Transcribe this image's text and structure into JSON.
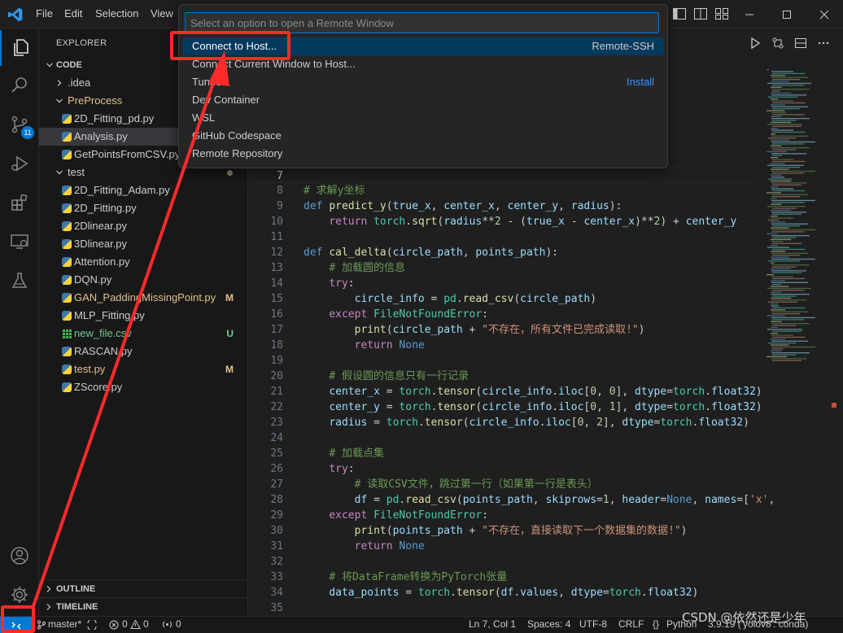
{
  "menu": {
    "file": "File",
    "edit": "Edit",
    "selection": "Selection",
    "view": "View"
  },
  "palette": {
    "placeholder": "Select an option to open a Remote Window",
    "items": [
      {
        "label": "Connect to Host...",
        "right": "Remote-SSH",
        "right_color": "#cccccc"
      },
      {
        "label": "Connect Current Window to Host...",
        "right": ""
      },
      {
        "label": "Tunnel",
        "right": "Install",
        "right_color": "#3794ff"
      },
      {
        "label": "Dev Container",
        "right": ""
      },
      {
        "label": "WSL",
        "right": ""
      },
      {
        "label": "GitHub Codespace",
        "right": ""
      },
      {
        "label": "Remote Repository",
        "right": ""
      }
    ]
  },
  "activity": {
    "scm_badge": "11"
  },
  "sidebar": {
    "header": "EXPLORER",
    "section": "CODE",
    "rows": [
      {
        "label": ".idea",
        "type": "folder",
        "open": false,
        "depth": 1,
        "color": "#cccccc",
        "badge": ""
      },
      {
        "label": "PreProcess",
        "type": "folder",
        "open": true,
        "depth": 1,
        "color": "#e2c08d",
        "badge": ""
      },
      {
        "label": "2D_Fitting_pd.py",
        "type": "py",
        "depth": 2,
        "color": "#cccccc",
        "badge": ""
      },
      {
        "label": "Analysis.py",
        "type": "py",
        "depth": 2,
        "color": "#cccccc",
        "badge": "",
        "selected": true
      },
      {
        "label": "GetPointsFromCSV.py",
        "type": "py",
        "depth": 2,
        "color": "#cccccc",
        "badge": ""
      },
      {
        "label": "test",
        "type": "folder",
        "open": true,
        "depth": 1,
        "color": "#cccccc",
        "badge": "dot"
      },
      {
        "label": "2D_Fitting_Adam.py",
        "type": "py",
        "depth": 2,
        "color": "#cccccc",
        "badge": ""
      },
      {
        "label": "2D_Fitting.py",
        "type": "py",
        "depth": 2,
        "color": "#cccccc",
        "badge": ""
      },
      {
        "label": "2Dlinear.py",
        "type": "py",
        "depth": 2,
        "color": "#cccccc",
        "badge": ""
      },
      {
        "label": "3Dlinear.py",
        "type": "py",
        "depth": 2,
        "color": "#cccccc",
        "badge": ""
      },
      {
        "label": "Attention.py",
        "type": "py",
        "depth": 2,
        "color": "#cccccc",
        "badge": ""
      },
      {
        "label": "DQN.py",
        "type": "py",
        "depth": 2,
        "color": "#cccccc",
        "badge": ""
      },
      {
        "label": "GAN_PaddingMissingPoint.py",
        "type": "py",
        "depth": 2,
        "color": "#e2c08d",
        "badge": "M",
        "badge_color": "#e2c08d"
      },
      {
        "label": "MLP_Fitting.py",
        "type": "py",
        "depth": 2,
        "color": "#cccccc",
        "badge": ""
      },
      {
        "label": "new_file.csv",
        "type": "csv",
        "depth": 2,
        "color": "#73c991",
        "badge": "U",
        "badge_color": "#73c991"
      },
      {
        "label": "RASCAN.py",
        "type": "py",
        "depth": 2,
        "color": "#cccccc",
        "badge": ""
      },
      {
        "label": "test.py",
        "type": "py",
        "depth": 2,
        "color": "#e2c08d",
        "badge": "M",
        "badge_color": "#e2c08d"
      },
      {
        "label": "ZScore.py",
        "type": "py",
        "depth": 2,
        "color": "#cccccc",
        "badge": ""
      }
    ],
    "outline": "OUTLINE",
    "timeline": "TIMELINE"
  },
  "code": [
    {
      "n": "7",
      "cur": true,
      "tokens": []
    },
    {
      "n": "8",
      "tokens": [
        [
          "cm",
          "# 求解y坐标"
        ]
      ]
    },
    {
      "n": "9",
      "tokens": [
        [
          "kw",
          "def "
        ],
        [
          "fn",
          "predict_y"
        ],
        [
          "p",
          "("
        ],
        [
          "var",
          "true_x"
        ],
        [
          "p",
          ", "
        ],
        [
          "var",
          "center_x"
        ],
        [
          "p",
          ", "
        ],
        [
          "var",
          "center_y"
        ],
        [
          "p",
          ", "
        ],
        [
          "var",
          "radius"
        ],
        [
          "p",
          "):"
        ]
      ]
    },
    {
      "n": "10",
      "tokens": [
        [
          "p",
          "    "
        ],
        [
          "ctl",
          "return "
        ],
        [
          "cls",
          "torch"
        ],
        [
          "p",
          "."
        ],
        [
          "fn",
          "sqrt"
        ],
        [
          "p",
          "("
        ],
        [
          "var",
          "radius"
        ],
        [
          "p",
          "**"
        ],
        [
          "num",
          "2"
        ],
        [
          "p",
          " - ("
        ],
        [
          "var",
          "true_x"
        ],
        [
          "p",
          " - "
        ],
        [
          "var",
          "center_x"
        ],
        [
          "p",
          ")**"
        ],
        [
          "num",
          "2"
        ],
        [
          "p",
          ") + "
        ],
        [
          "var",
          "center_y"
        ]
      ]
    },
    {
      "n": "11",
      "tokens": []
    },
    {
      "n": "12",
      "tokens": [
        [
          "kw",
          "def "
        ],
        [
          "fn",
          "cal_delta"
        ],
        [
          "p",
          "("
        ],
        [
          "var",
          "circle_path"
        ],
        [
          "p",
          ", "
        ],
        [
          "var",
          "points_path"
        ],
        [
          "p",
          "):"
        ]
      ]
    },
    {
      "n": "13",
      "tokens": [
        [
          "p",
          "    "
        ],
        [
          "cm",
          "# 加载圆的信息"
        ]
      ]
    },
    {
      "n": "14",
      "tokens": [
        [
          "p",
          "    "
        ],
        [
          "ctl",
          "try"
        ],
        [
          "p",
          ":"
        ]
      ]
    },
    {
      "n": "15",
      "tokens": [
        [
          "p",
          "        "
        ],
        [
          "var",
          "circle_info"
        ],
        [
          "p",
          " = "
        ],
        [
          "cls",
          "pd"
        ],
        [
          "p",
          "."
        ],
        [
          "fn",
          "read_csv"
        ],
        [
          "p",
          "("
        ],
        [
          "var",
          "circle_path"
        ],
        [
          "p",
          ")"
        ]
      ]
    },
    {
      "n": "16",
      "tokens": [
        [
          "p",
          "    "
        ],
        [
          "ctl",
          "except "
        ],
        [
          "cls",
          "FileNotFoundError"
        ],
        [
          "p",
          ":"
        ]
      ]
    },
    {
      "n": "17",
      "tokens": [
        [
          "p",
          "        "
        ],
        [
          "fn",
          "print"
        ],
        [
          "p",
          "("
        ],
        [
          "var",
          "circle_path"
        ],
        [
          "p",
          " + "
        ],
        [
          "str",
          "\"不存在，所有文件已完成读取!\""
        ],
        [
          "p",
          ")"
        ]
      ]
    },
    {
      "n": "18",
      "tokens": [
        [
          "p",
          "        "
        ],
        [
          "ctl",
          "return "
        ],
        [
          "kw",
          "None"
        ]
      ]
    },
    {
      "n": "19",
      "tokens": []
    },
    {
      "n": "20",
      "tokens": [
        [
          "p",
          "    "
        ],
        [
          "cm",
          "# 假设圆的信息只有一行记录"
        ]
      ]
    },
    {
      "n": "21",
      "tokens": [
        [
          "p",
          "    "
        ],
        [
          "var",
          "center_x"
        ],
        [
          "p",
          " = "
        ],
        [
          "cls",
          "torch"
        ],
        [
          "p",
          "."
        ],
        [
          "fn",
          "tensor"
        ],
        [
          "p",
          "("
        ],
        [
          "var",
          "circle_info"
        ],
        [
          "p",
          "."
        ],
        [
          "var",
          "iloc"
        ],
        [
          "p",
          "["
        ],
        [
          "num",
          "0"
        ],
        [
          "p",
          ", "
        ],
        [
          "num",
          "0"
        ],
        [
          "p",
          "], "
        ],
        [
          "var",
          "dtype"
        ],
        [
          "p",
          "="
        ],
        [
          "cls",
          "torch"
        ],
        [
          "p",
          "."
        ],
        [
          "var",
          "float32"
        ],
        [
          "p",
          ")"
        ]
      ]
    },
    {
      "n": "22",
      "tokens": [
        [
          "p",
          "    "
        ],
        [
          "var",
          "center_y"
        ],
        [
          "p",
          " = "
        ],
        [
          "cls",
          "torch"
        ],
        [
          "p",
          "."
        ],
        [
          "fn",
          "tensor"
        ],
        [
          "p",
          "("
        ],
        [
          "var",
          "circle_info"
        ],
        [
          "p",
          "."
        ],
        [
          "var",
          "iloc"
        ],
        [
          "p",
          "["
        ],
        [
          "num",
          "0"
        ],
        [
          "p",
          ", "
        ],
        [
          "num",
          "1"
        ],
        [
          "p",
          "], "
        ],
        [
          "var",
          "dtype"
        ],
        [
          "p",
          "="
        ],
        [
          "cls",
          "torch"
        ],
        [
          "p",
          "."
        ],
        [
          "var",
          "float32"
        ],
        [
          "p",
          ")"
        ]
      ]
    },
    {
      "n": "23",
      "tokens": [
        [
          "p",
          "    "
        ],
        [
          "var",
          "radius"
        ],
        [
          "p",
          " = "
        ],
        [
          "cls",
          "torch"
        ],
        [
          "p",
          "."
        ],
        [
          "fn",
          "tensor"
        ],
        [
          "p",
          "("
        ],
        [
          "var",
          "circle_info"
        ],
        [
          "p",
          "."
        ],
        [
          "var",
          "iloc"
        ],
        [
          "p",
          "["
        ],
        [
          "num",
          "0"
        ],
        [
          "p",
          ", "
        ],
        [
          "num",
          "2"
        ],
        [
          "p",
          "], "
        ],
        [
          "var",
          "dtype"
        ],
        [
          "p",
          "="
        ],
        [
          "cls",
          "torch"
        ],
        [
          "p",
          "."
        ],
        [
          "var",
          "float32"
        ],
        [
          "p",
          ")"
        ]
      ]
    },
    {
      "n": "24",
      "tokens": []
    },
    {
      "n": "25",
      "tokens": [
        [
          "p",
          "    "
        ],
        [
          "cm",
          "# 加载点集"
        ]
      ]
    },
    {
      "n": "26",
      "tokens": [
        [
          "p",
          "    "
        ],
        [
          "ctl",
          "try"
        ],
        [
          "p",
          ":"
        ]
      ]
    },
    {
      "n": "27",
      "tokens": [
        [
          "p",
          "        "
        ],
        [
          "cm",
          "# 读取CSV文件，跳过第一行（如果第一行是表头）"
        ]
      ]
    },
    {
      "n": "28",
      "tokens": [
        [
          "p",
          "        "
        ],
        [
          "var",
          "df"
        ],
        [
          "p",
          " = "
        ],
        [
          "cls",
          "pd"
        ],
        [
          "p",
          "."
        ],
        [
          "fn",
          "read_csv"
        ],
        [
          "p",
          "("
        ],
        [
          "var",
          "points_path"
        ],
        [
          "p",
          ", "
        ],
        [
          "var",
          "skiprows"
        ],
        [
          "p",
          "="
        ],
        [
          "num",
          "1"
        ],
        [
          "p",
          ", "
        ],
        [
          "var",
          "header"
        ],
        [
          "p",
          "="
        ],
        [
          "kw",
          "None"
        ],
        [
          "p",
          ", "
        ],
        [
          "var",
          "names"
        ],
        [
          "p",
          "=["
        ],
        [
          "str",
          "'x'"
        ],
        [
          "p",
          ","
        ]
      ]
    },
    {
      "n": "29",
      "tokens": [
        [
          "p",
          "    "
        ],
        [
          "ctl",
          "except "
        ],
        [
          "cls",
          "FileNotFoundError"
        ],
        [
          "p",
          ":"
        ]
      ]
    },
    {
      "n": "30",
      "tokens": [
        [
          "p",
          "        "
        ],
        [
          "fn",
          "print"
        ],
        [
          "p",
          "("
        ],
        [
          "var",
          "points_path"
        ],
        [
          "p",
          " + "
        ],
        [
          "str",
          "\"不存在，直接读取下一个数据集的数据!\""
        ],
        [
          "p",
          ")"
        ]
      ]
    },
    {
      "n": "31",
      "tokens": [
        [
          "p",
          "        "
        ],
        [
          "ctl",
          "return "
        ],
        [
          "kw",
          "None"
        ]
      ]
    },
    {
      "n": "32",
      "tokens": []
    },
    {
      "n": "33",
      "tokens": [
        [
          "p",
          "    "
        ],
        [
          "cm",
          "# 将DataFrame转换为PyTorch张量"
        ]
      ]
    },
    {
      "n": "34",
      "tokens": [
        [
          "p",
          "    "
        ],
        [
          "var",
          "data_points"
        ],
        [
          "p",
          " = "
        ],
        [
          "cls",
          "torch"
        ],
        [
          "p",
          "."
        ],
        [
          "fn",
          "tensor"
        ],
        [
          "p",
          "("
        ],
        [
          "var",
          "df"
        ],
        [
          "p",
          "."
        ],
        [
          "var",
          "values"
        ],
        [
          "p",
          ", "
        ],
        [
          "var",
          "dtype"
        ],
        [
          "p",
          "="
        ],
        [
          "cls",
          "torch"
        ],
        [
          "p",
          "."
        ],
        [
          "var",
          "float32"
        ],
        [
          "p",
          ")"
        ]
      ]
    },
    {
      "n": "35",
      "tokens": []
    }
  ],
  "status": {
    "branch": "master*",
    "errors": "0",
    "warnings": "0",
    "ports": "0",
    "position": "Ln 7, Col 1",
    "spaces": "Spaces: 4",
    "encoding": "UTF-8",
    "eol": "CRLF",
    "braces": "{}",
    "language": "Python",
    "interpreter": "3.9.19 ('yolov8': conda)"
  },
  "watermark": "CSDN @依然还是少年",
  "colors": {
    "accent": "#0078d4",
    "annotation": "#ff2a2a"
  }
}
